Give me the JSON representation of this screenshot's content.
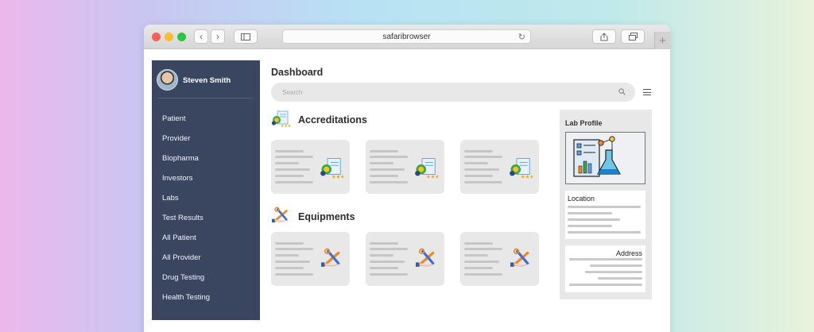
{
  "browser": {
    "address": "safaribrowser"
  },
  "sidebar": {
    "user_name": "Steven Smith",
    "items": [
      {
        "label": "Patient"
      },
      {
        "label": "Provider"
      },
      {
        "label": "Biopharma"
      },
      {
        "label": "Investors"
      },
      {
        "label": "Labs"
      },
      {
        "label": "Test Results"
      },
      {
        "label": "All Patient"
      },
      {
        "label": "All Provider"
      },
      {
        "label": "Drug Testing"
      },
      {
        "label": "Health Testing"
      }
    ]
  },
  "main": {
    "title": "Dashboard",
    "search_placeholder": "Search",
    "sections": [
      {
        "title": "Accreditations",
        "icon": "certificate-icon",
        "card_count": 3
      },
      {
        "title": "Equipments",
        "icon": "tools-icon",
        "card_count": 3
      }
    ]
  },
  "lab_profile": {
    "title": "Lab Profile",
    "icon": "lab-report-icon",
    "location_label": "Location",
    "address_label": "Address"
  },
  "colors": {
    "sidebar_bg": "#3a4660",
    "card_bg": "#e8e8e8",
    "placeholder_line": "#c6c6c6"
  }
}
